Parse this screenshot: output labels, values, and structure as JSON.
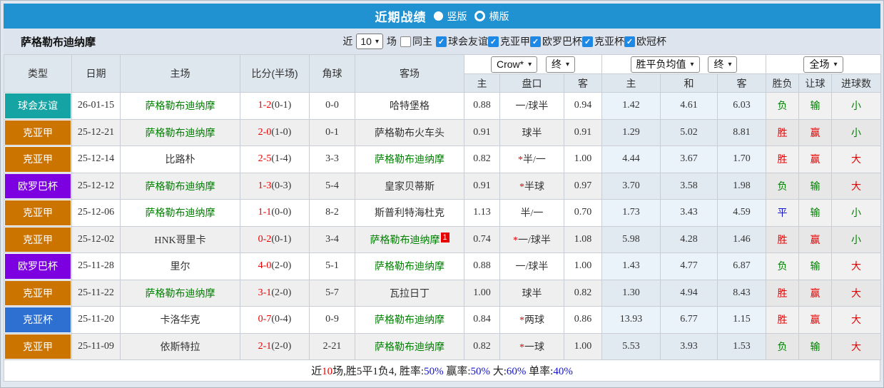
{
  "titlebar": {
    "title": "近期战绩",
    "layout_options": [
      {
        "label": "竖版",
        "selected": true
      },
      {
        "label": "横版",
        "selected": false
      }
    ]
  },
  "filterbar": {
    "team_name": "萨格勒布迪纳摩",
    "recent_prefix": "近",
    "recent_count": "10",
    "recent_suffix": "场",
    "same_home": {
      "label": "同主",
      "checked": false
    },
    "competitions": [
      {
        "label": "球会友谊",
        "checked": true
      },
      {
        "label": "克亚甲",
        "checked": true
      },
      {
        "label": "欧罗巴杯",
        "checked": true
      },
      {
        "label": "克亚杯",
        "checked": true
      },
      {
        "label": "欧冠杯",
        "checked": true
      }
    ]
  },
  "table": {
    "left_headers": [
      "类型",
      "日期",
      "主场",
      "比分(半场)",
      "角球",
      "客场"
    ],
    "dropdowns": {
      "odds_company": "Crow*",
      "odds_company_time": "终",
      "avg_label": "胜平负均值",
      "avg_time": "终",
      "scope": "全场"
    },
    "sub_headers": [
      "主",
      "盘口",
      "客",
      "主",
      "和",
      "客",
      "胜负",
      "让球",
      "进球数"
    ],
    "rows": [
      {
        "type": "球会友谊",
        "date": "26-01-15",
        "home": "萨格勒布迪纳摩",
        "home_is_team": true,
        "score_ft": "1-2",
        "score_ht": "(0-1)",
        "corner": "0-0",
        "away": "哈特堡格",
        "away_is_team": false,
        "away_badge": "",
        "odds_home": "0.88",
        "handicap": "一/球半",
        "handicap_star": false,
        "odds_away": "0.94",
        "avg_home": "1.42",
        "avg_draw": "4.61",
        "avg_away": "6.03",
        "result": "负",
        "handicap_result": "输",
        "goals": "小"
      },
      {
        "type": "克亚甲",
        "date": "25-12-21",
        "home": "萨格勒布迪纳摩",
        "home_is_team": true,
        "score_ft": "2-0",
        "score_ht": "(1-0)",
        "corner": "0-1",
        "away": "萨格勒布火车头",
        "away_is_team": false,
        "away_badge": "",
        "odds_home": "0.91",
        "handicap": "球半",
        "handicap_star": false,
        "odds_away": "0.91",
        "avg_home": "1.29",
        "avg_draw": "5.02",
        "avg_away": "8.81",
        "result": "胜",
        "handicap_result": "赢",
        "goals": "小"
      },
      {
        "type": "克亚甲",
        "date": "25-12-14",
        "home": "比路朴",
        "home_is_team": false,
        "score_ft": "2-5",
        "score_ht": "(1-4)",
        "corner": "3-3",
        "away": "萨格勒布迪纳摩",
        "away_is_team": true,
        "away_badge": "",
        "odds_home": "0.82",
        "handicap": "半/一",
        "handicap_star": true,
        "odds_away": "1.00",
        "avg_home": "4.44",
        "avg_draw": "3.67",
        "avg_away": "1.70",
        "result": "胜",
        "handicap_result": "赢",
        "goals": "大"
      },
      {
        "type": "欧罗巴杯",
        "date": "25-12-12",
        "home": "萨格勒布迪纳摩",
        "home_is_team": true,
        "score_ft": "1-3",
        "score_ht": "(0-3)",
        "corner": "5-4",
        "away": "皇家贝蒂斯",
        "away_is_team": false,
        "away_badge": "",
        "odds_home": "0.91",
        "handicap": "半球",
        "handicap_star": true,
        "odds_away": "0.97",
        "avg_home": "3.70",
        "avg_draw": "3.58",
        "avg_away": "1.98",
        "result": "负",
        "handicap_result": "输",
        "goals": "大"
      },
      {
        "type": "克亚甲",
        "date": "25-12-06",
        "home": "萨格勒布迪纳摩",
        "home_is_team": true,
        "score_ft": "1-1",
        "score_ht": "(0-0)",
        "corner": "8-2",
        "away": "斯普利特海杜克",
        "away_is_team": false,
        "away_badge": "",
        "odds_home": "1.13",
        "handicap": "半/一",
        "handicap_star": false,
        "odds_away": "0.70",
        "avg_home": "1.73",
        "avg_draw": "3.43",
        "avg_away": "4.59",
        "result": "平",
        "handicap_result": "输",
        "goals": "小"
      },
      {
        "type": "克亚甲",
        "date": "25-12-02",
        "home": "HNK哥里卡",
        "home_is_team": false,
        "score_ft": "0-2",
        "score_ht": "(0-1)",
        "corner": "3-4",
        "away": "萨格勒布迪纳摩",
        "away_is_team": true,
        "away_badge": "1",
        "odds_home": "0.74",
        "handicap": "一/球半",
        "handicap_star": true,
        "odds_away": "1.08",
        "avg_home": "5.98",
        "avg_draw": "4.28",
        "avg_away": "1.46",
        "result": "胜",
        "handicap_result": "赢",
        "goals": "小"
      },
      {
        "type": "欧罗巴杯",
        "date": "25-11-28",
        "home": "里尔",
        "home_is_team": false,
        "score_ft": "4-0",
        "score_ht": "(2-0)",
        "corner": "5-1",
        "away": "萨格勒布迪纳摩",
        "away_is_team": true,
        "away_badge": "",
        "odds_home": "0.88",
        "handicap": "一/球半",
        "handicap_star": false,
        "odds_away": "1.00",
        "avg_home": "1.43",
        "avg_draw": "4.77",
        "avg_away": "6.87",
        "result": "负",
        "handicap_result": "输",
        "goals": "大"
      },
      {
        "type": "克亚甲",
        "date": "25-11-22",
        "home": "萨格勒布迪纳摩",
        "home_is_team": true,
        "score_ft": "3-1",
        "score_ht": "(2-0)",
        "corner": "5-7",
        "away": "瓦拉日丁",
        "away_is_team": false,
        "away_badge": "",
        "odds_home": "1.00",
        "handicap": "球半",
        "handicap_star": false,
        "odds_away": "0.82",
        "avg_home": "1.30",
        "avg_draw": "4.94",
        "avg_away": "8.43",
        "result": "胜",
        "handicap_result": "赢",
        "goals": "大"
      },
      {
        "type": "克亚杯",
        "date": "25-11-20",
        "home": "卡洛华克",
        "home_is_team": false,
        "score_ft": "0-7",
        "score_ht": "(0-4)",
        "corner": "0-9",
        "away": "萨格勒布迪纳摩",
        "away_is_team": true,
        "away_badge": "",
        "odds_home": "0.84",
        "handicap": "两球",
        "handicap_star": true,
        "odds_away": "0.86",
        "avg_home": "13.93",
        "avg_draw": "6.77",
        "avg_away": "1.15",
        "result": "胜",
        "handicap_result": "赢",
        "goals": "大"
      },
      {
        "type": "克亚甲",
        "date": "25-11-09",
        "home": "依斯特拉",
        "home_is_team": false,
        "score_ft": "2-1",
        "score_ht": "(2-0)",
        "corner": "2-21",
        "away": "萨格勒布迪纳摩",
        "away_is_team": true,
        "away_badge": "",
        "odds_home": "0.82",
        "handicap": "一球",
        "handicap_star": true,
        "odds_away": "1.00",
        "avg_home": "5.53",
        "avg_draw": "3.93",
        "avg_away": "1.53",
        "result": "负",
        "handicap_result": "输",
        "goals": "大"
      }
    ]
  },
  "footer": {
    "segments": [
      {
        "text": "近",
        "color": "default"
      },
      {
        "text": "10",
        "color": "red"
      },
      {
        "text": "场,胜5平1负4, 胜率:",
        "color": "default"
      },
      {
        "text": "50%",
        "color": "blue"
      },
      {
        "text": " 赢率:",
        "color": "default"
      },
      {
        "text": "50%",
        "color": "blue"
      },
      {
        "text": " 大:",
        "color": "default"
      },
      {
        "text": "60%",
        "color": "blue"
      },
      {
        "text": " 单率:",
        "color": "default"
      },
      {
        "text": "40%",
        "color": "blue"
      }
    ]
  },
  "colors": {
    "accent_blue": "#2092d2",
    "type_badge": {
      "球会友谊": "#16a3a3",
      "克亚甲": "#cc7400",
      "欧罗巴杯": "#7d00e0",
      "克亚杯": "#2e6fd2"
    },
    "outcome": {
      "胜": "#e60000",
      "平": "#1414cc",
      "负": "#008000",
      "赢": "#e60000",
      "输": "#008000",
      "大": "#e60000",
      "小": "#008000"
    },
    "team_green": "#008000",
    "score_red": "#e60000",
    "text_red": "#e60000",
    "text_blue": "#1414cc"
  }
}
